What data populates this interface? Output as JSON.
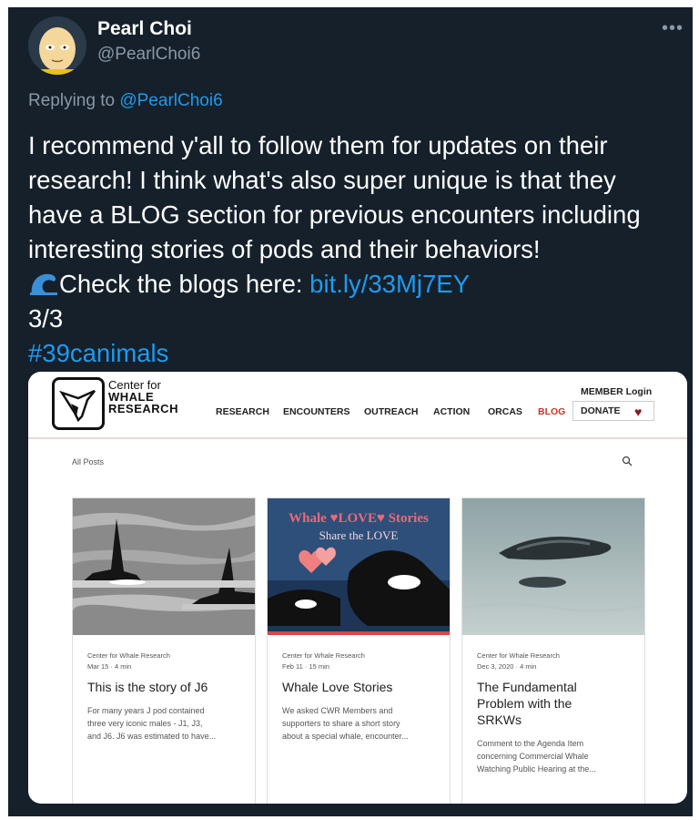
{
  "tweet": {
    "author_name": "Pearl Choi",
    "author_handle": "@PearlChoi6",
    "more_icon": "more-options-icon",
    "reply_prefix": "Replying to",
    "reply_handle": "@PearlChoi6",
    "body_line1": "I recommend y'all to follow them for updates on their",
    "body_line2": "research! I think what's also super unique is that they",
    "body_line3": "have a BLOG section for previous encounters including",
    "body_line4": "interesting stories of pods and their behaviors!",
    "check_text": "Check the blogs here: ",
    "link_text": "bit.ly/33Mj7EY",
    "counter": "3/3",
    "hashtag": "#39canimals",
    "link_color": "#1d9bf0",
    "background_color": "#15202b"
  },
  "site": {
    "logo_line1": "Center for",
    "logo_line2": "WHALE",
    "logo_line3": "RESEARCH",
    "nav": [
      "RESEARCH",
      "ENCOUNTERS",
      "OUTREACH",
      "ACTION",
      "ORCAS",
      "BLOG"
    ],
    "member_login": "MEMBER Login",
    "donate": "DONATE",
    "all_posts": "All Posts",
    "accent_color": "#c0392b"
  },
  "posts": [
    {
      "author": "Center for Whale Research",
      "date": "Mar 15 · 4 min",
      "title": "This is the story of J6",
      "excerpt_1": "For many years J pod contained",
      "excerpt_2": "three very iconic males - J1, J3,",
      "excerpt_3": "and J6. J6 was estimated to have..."
    },
    {
      "author": "Center for Whale Research",
      "date": "Feb 11 · 15 min",
      "title": "Whale Love Stories",
      "image_banner": "Whale ♥LOVE♥ Stories",
      "image_subtitle": "Share the LOVE",
      "excerpt_1": "We asked CWR Members and",
      "excerpt_2": "supporters to share a short story",
      "excerpt_3": "about a special whale, encounter..."
    },
    {
      "author": "Center for Whale Research",
      "date": "Dec 3, 2020 · 4 min",
      "title_1": "The Fundamental",
      "title_2": "Problem with the",
      "title_3": "SRKWs",
      "excerpt_1": "Comment to the Agenda Item",
      "excerpt_2": "concerning Commercial Whale",
      "excerpt_3": "Watching Public Hearing at the..."
    }
  ]
}
